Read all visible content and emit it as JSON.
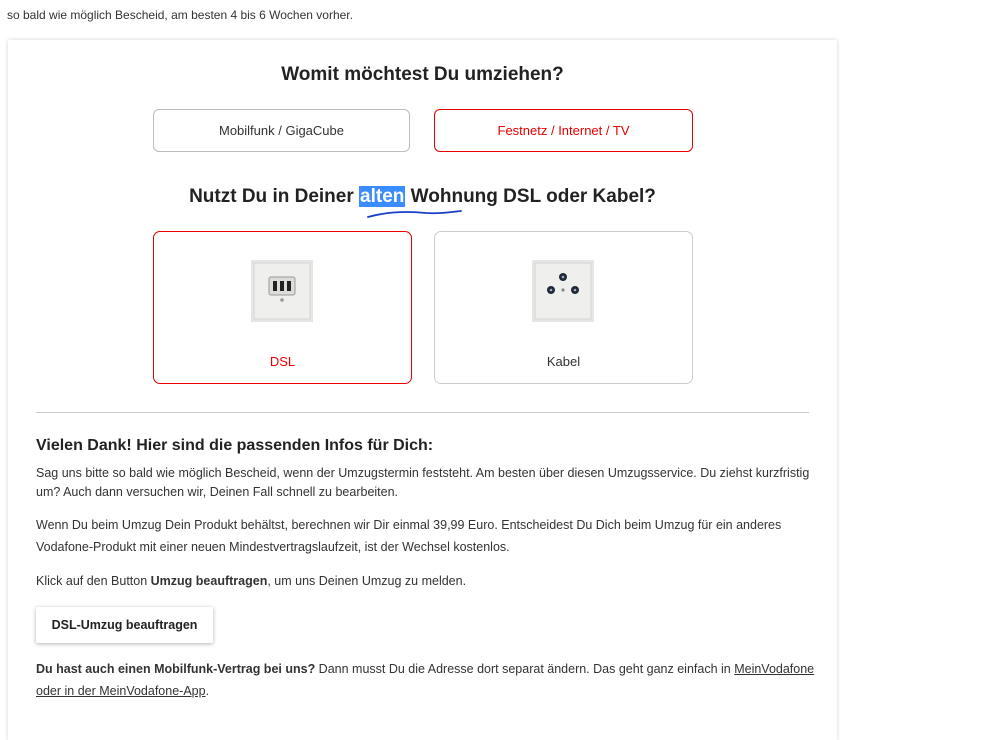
{
  "intro_text": "so bald wie möglich Bescheid, am besten 4 bis 6 Wochen vorher.",
  "question1": "Womit möchtest Du umziehen?",
  "options": {
    "mobile": "Mobilfunk / GigaCube",
    "fixed": "Festnetz / Internet / TV"
  },
  "question2": {
    "before": "Nutzt Du in Deiner ",
    "highlight": "alten",
    "after": " Wohnung DSL oder Kabel?"
  },
  "tiles": {
    "dsl": "DSL",
    "cable": "Kabel"
  },
  "info": {
    "title": "Vielen Dank! Hier sind die passenden Infos für Dich:",
    "p1": "Sag uns bitte so bald wie möglich Bescheid, wenn der Umzugstermin feststeht. Am besten über diesen Umzugsservice. Du ziehst kurzfristig um? Auch dann versuchen wir, Deinen Fall schnell zu bearbeiten.",
    "p2": "Wenn Du beim Umzug Dein Produkt behältst, berechnen wir Dir einmal 39,99 Euro. Entscheidest Du Dich beim Umzug für ein anderes Vodafone-Produkt mit einer neuen Mindestvertragslaufzeit, ist der Wechsel kostenlos.",
    "p3_before": "Klick auf den Button ",
    "p3_bold": "Umzug beauftragen",
    "p3_after": ", um uns Deinen Umzug zu melden.",
    "button": "DSL-Umzug beauftragen",
    "p4_bold": "Du hast auch einen Mobilfunk-Vertrag bei uns?",
    "p4_text": " Dann musst Du die Adresse dort separat ändern. Das geht ganz einfach in ",
    "p4_link": "MeinVodafone oder in der MeinVodafone-App",
    "p4_end": "."
  },
  "colors": {
    "accent": "#e60000",
    "highlight": "#3b8cff",
    "pen_underline": "#1a3ec8"
  }
}
